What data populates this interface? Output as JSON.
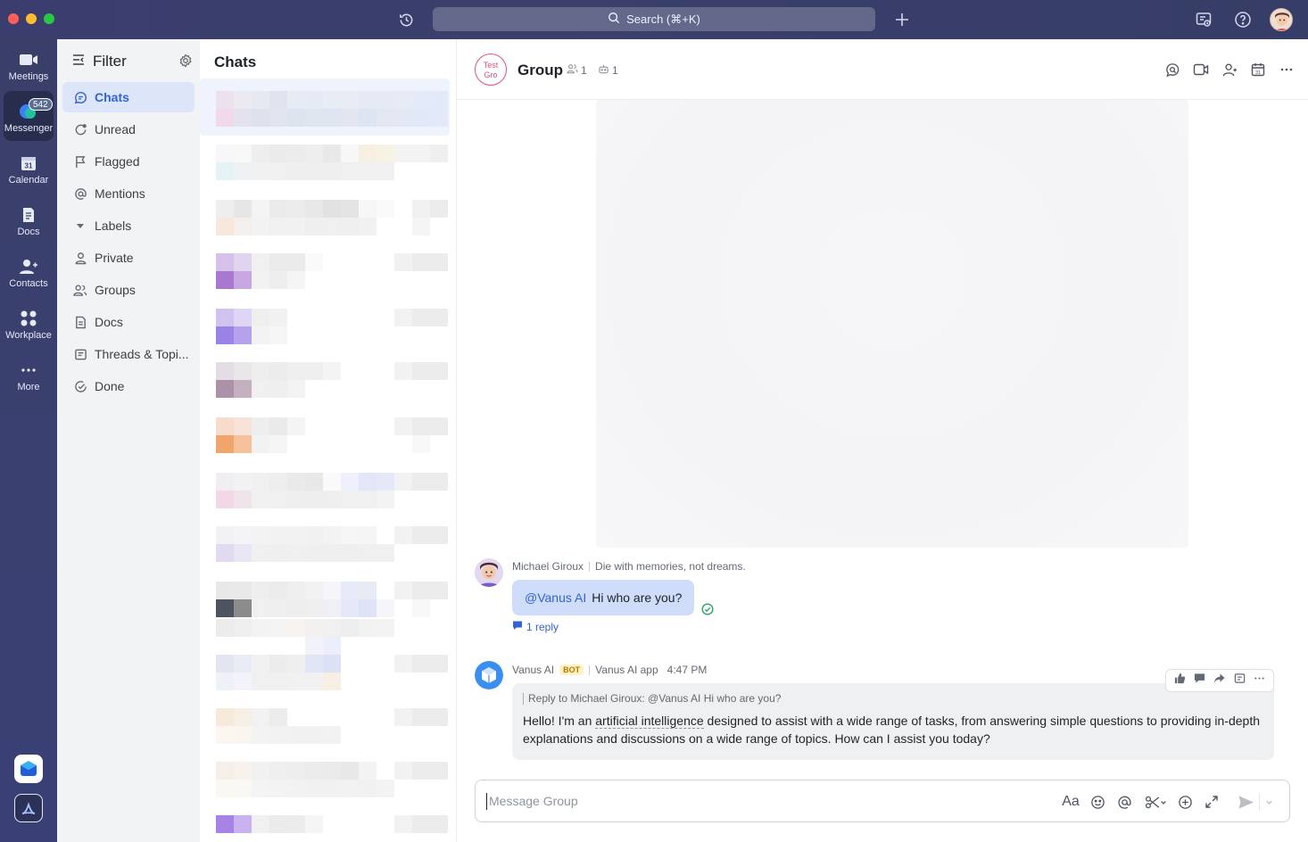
{
  "titlebar": {
    "search_label": "Search (⌘+K)",
    "icons": [
      "history-icon",
      "search-icon",
      "plus-icon",
      "tasks-icon",
      "help-icon",
      "avatar"
    ]
  },
  "rail": {
    "items": [
      {
        "label": "Meetings",
        "icon": "video-camera-icon"
      },
      {
        "label": "Messenger",
        "icon": "chat-bubble-icon",
        "badge": "542"
      },
      {
        "label": "Calendar",
        "icon": "calendar-icon",
        "icon_text": "31"
      },
      {
        "label": "Docs",
        "icon": "doc-icon"
      },
      {
        "label": "Contacts",
        "icon": "contacts-icon"
      },
      {
        "label": "Workplace",
        "icon": "grid-icon"
      },
      {
        "label": "More",
        "icon": "more-icon"
      }
    ]
  },
  "filter": {
    "title": "Filter",
    "items": [
      {
        "label": "Chats",
        "icon": "chat-icon",
        "active": true
      },
      {
        "label": "Unread",
        "icon": "unread-icon"
      },
      {
        "label": "Flagged",
        "icon": "flag-icon"
      },
      {
        "label": "Mentions",
        "icon": "at-icon"
      },
      {
        "label": "Labels",
        "icon": "caret-down-icon"
      },
      {
        "label": "Private",
        "icon": "person-icon"
      },
      {
        "label": "Groups",
        "icon": "group-icon"
      },
      {
        "label": "Docs",
        "icon": "doc-icon"
      },
      {
        "label": "Threads & Topi...",
        "icon": "threads-icon"
      },
      {
        "label": "Done",
        "icon": "check-circle-icon"
      }
    ]
  },
  "chatlist": {
    "title": "Chats"
  },
  "conversation": {
    "group_avatar_text": [
      "Test",
      "Gro"
    ],
    "group_name": "Group",
    "member_count": "1",
    "bot_count": "1",
    "messages": [
      {
        "sender": "Michael Giroux",
        "status": "Die with memories, not dreams.",
        "mention": "@Vanus AI",
        "text": "Hi who are you?",
        "reply_link": "1 reply"
      },
      {
        "sender": "Vanus AI",
        "tag": "BOT",
        "source": "Vanus AI app",
        "time": "4:47 PM",
        "quote": "Reply to Michael Giroux:  @Vanus AI Hi who are you?",
        "text_before": "Hello! I'm an ",
        "text_highlight": "artificial intelligence",
        "text_after": " designed to assist with a wide range of tasks, from answering simple questions to providing in-depth explanations and discussions on a wide range of topics. How can I assist you today?"
      }
    ]
  },
  "composer": {
    "placeholder": "Message Group",
    "format_label": "Aa"
  },
  "colors": {
    "titlebar": "#3b3d6e",
    "accent": "#3363d4",
    "group_avatar": "#e34d89",
    "bot_tag": "#fff3c4"
  }
}
